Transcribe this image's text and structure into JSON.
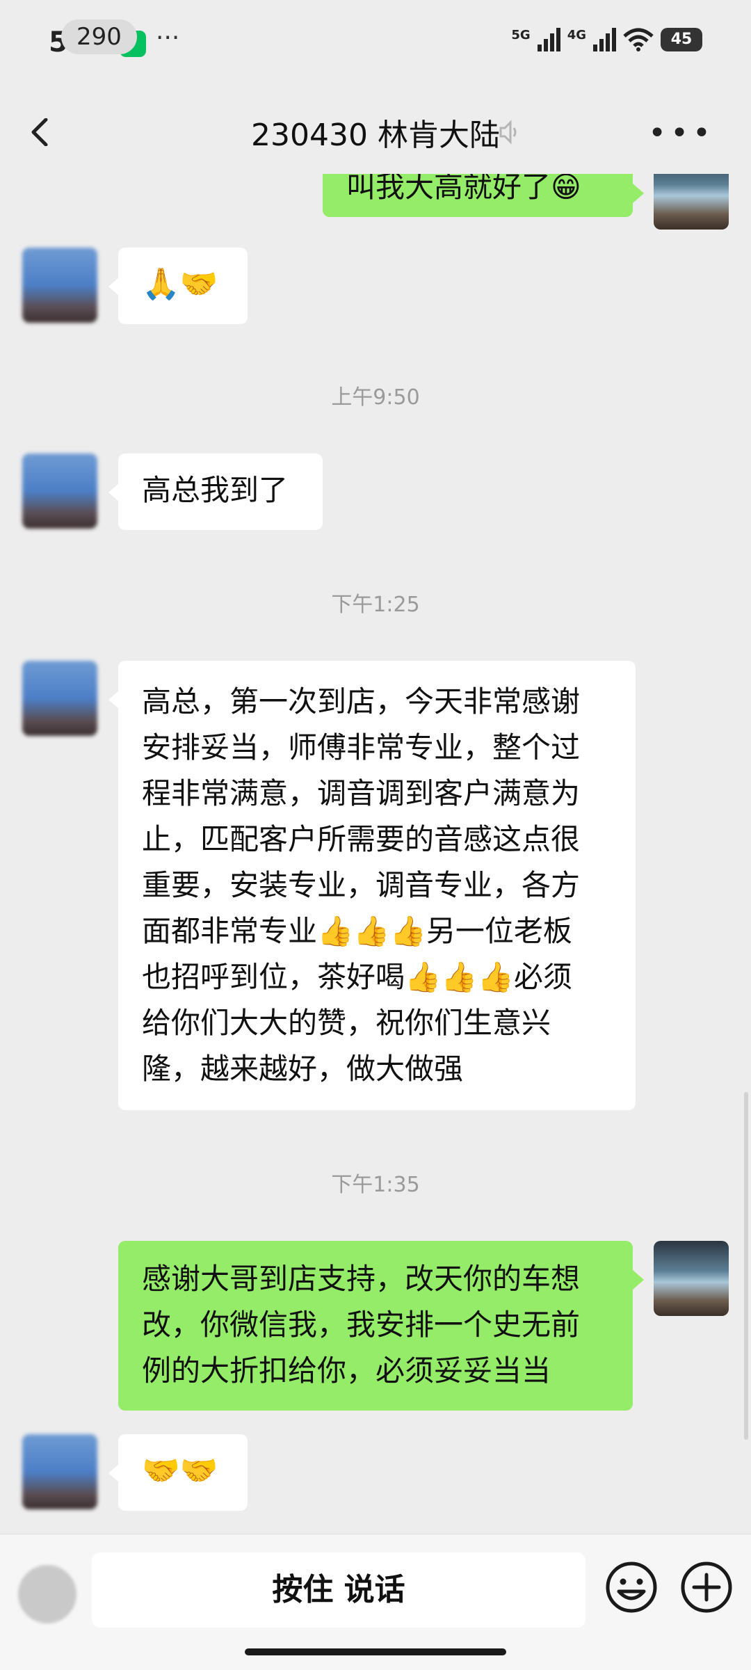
{
  "status_bar": {
    "time": "5:38",
    "dots": "···",
    "network1": "5G",
    "network2": "4G",
    "battery": "45"
  },
  "nav": {
    "unread_count": "290",
    "title": "230430 林肯大陆"
  },
  "messages": [
    {
      "text": "叫我大高就好了😁"
    },
    {
      "text": "🙏🤝"
    },
    {
      "text": "高总我到了"
    },
    {
      "lines": [
        "高总，第一次到店，今天非常感谢",
        "安排妥当，师傅非常专业，整个过",
        "程非常满意，调音调到客户满意为",
        "止，匹配客户所需要的音感这点很",
        "重要，安装专业，调音专业，各方",
        "面都非常专业👍👍👍另一位老板",
        "也招呼到位，茶好喝👍👍👍必须",
        "给你们大大的赞，祝你们生意兴",
        "隆，越来越好，做大做强"
      ]
    },
    {
      "lines": [
        "感谢大哥到店支持，改天你的车想",
        "改，你微信我，我安排一个史无前",
        "例的大折扣给你，必须妥妥当当"
      ]
    },
    {
      "text": "🤝🤝"
    }
  ],
  "timestamps": [
    "上午9:50",
    "下午1:25",
    "下午1:35"
  ],
  "input_bar": {
    "talk_label": "按住 说话"
  },
  "colors": {
    "background": "#ededed",
    "self_bubble": "#95ec69",
    "other_bubble": "#ffffff"
  }
}
